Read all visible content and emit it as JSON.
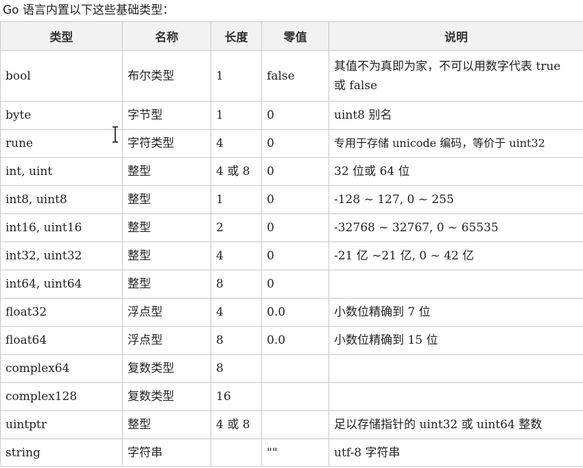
{
  "intro": "Go 语言内置以下这些基础类型：",
  "table": {
    "headers": [
      "类型",
      "名称",
      "长度",
      "零值",
      "说明"
    ],
    "rows": [
      [
        "bool",
        "布尔类型",
        "1",
        "false",
        "其值不为真即为家，不可以用数字代表 true 或 false"
      ],
      [
        "byte",
        "字节型",
        "1",
        "0",
        "uint8 别名"
      ],
      [
        "rune",
        "字符类型",
        "4",
        "0",
        "专用于存储 unicode 编码，等价于 uint32"
      ],
      [
        "int, uint",
        "整型",
        "4 或 8",
        "0",
        "32 位或 64 位"
      ],
      [
        "int8, uint8",
        "整型",
        "1",
        "0",
        "-128 ~ 127, 0 ~ 255"
      ],
      [
        "int16, uint16",
        "整型",
        "2",
        "0",
        "-32768 ~ 32767, 0 ~ 65535"
      ],
      [
        "int32, uint32",
        "整型",
        "4",
        "0",
        "-21 亿 ~21 亿, 0 ~ 42 亿"
      ],
      [
        "int64, uint64",
        "整型",
        "8",
        "0",
        ""
      ],
      [
        "float32",
        "浮点型",
        "4",
        "0.0",
        "小数位精确到 7 位"
      ],
      [
        "float64",
        "浮点型",
        "8",
        "0.0",
        "小数位精确到 15 位"
      ],
      [
        "complex64",
        "复数类型",
        "8",
        "",
        ""
      ],
      [
        "complex128",
        "复数类型",
        "16",
        "",
        ""
      ],
      [
        "uintptr",
        "整型",
        "4 或 8",
        "",
        "足以存储指针的 uint32 或 uint64 整数"
      ],
      [
        "string",
        "字符串",
        "",
        "\"\"",
        "utf-8 字符串"
      ]
    ]
  },
  "cursor": {
    "icon": "text-cursor-icon"
  }
}
